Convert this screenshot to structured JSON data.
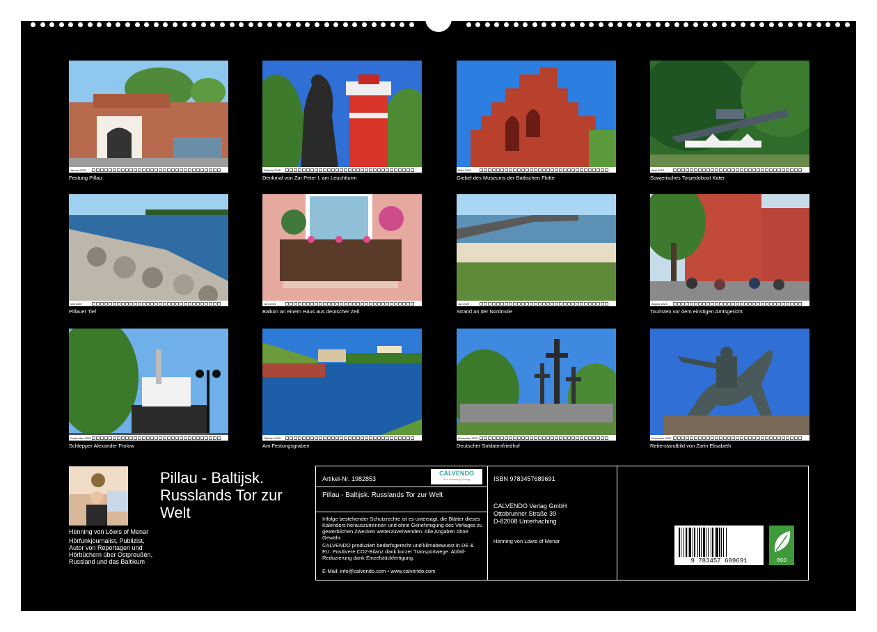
{
  "months": [
    {
      "name": "Januar 2025",
      "caption": "Festung Pillau"
    },
    {
      "name": "Februar 2025",
      "caption": "Denkmal von Zar Peter I. am Leuchtturm"
    },
    {
      "name": "März 2025",
      "caption": "Giebel des Museums der Baltischen Flotte"
    },
    {
      "name": "April 2025",
      "caption": "Sowjetisches Torpedoboot Kater"
    },
    {
      "name": "Mai 2025",
      "caption": "Pillauer Tief"
    },
    {
      "name": "Juni 2025",
      "caption": "Balkon an einem Haus aus deutscher Zeit"
    },
    {
      "name": "Juli 2025",
      "caption": "Strand an der Nordmole"
    },
    {
      "name": "August 2025",
      "caption": "Touristen vor dem einstigen Amtsgericht"
    },
    {
      "name": "September 2025",
      "caption": "Schlepper Alexander Frolow"
    },
    {
      "name": "Oktober 2025",
      "caption": "Am Festungsgraben"
    },
    {
      "name": "November 2025",
      "caption": "Deutscher Soldatenfriedhof"
    },
    {
      "name": "Dezember 2025",
      "caption": "Reiterstandbild von Zarin Elisabeth"
    }
  ],
  "author": {
    "name": "Henning von Löwis of Menar",
    "bio": "Hörfunkjournalist, Publizist, Autor von Reportagen und Hörbüchern über Ostpreußen, Russland und das Baltikum"
  },
  "title": "Pillau - Baltijsk. Russlands Tor zur Welt",
  "info": {
    "article": "Artikel-Nr. 1982853",
    "logo": "CALVENDO",
    "logo_sub": "Bee Marketing Verlag",
    "book_title": "Pillau - Baltijsk. Russlands Tor zur Welt",
    "legal": "Infolge bestehender Schutzrechte ist es untersagt, die Blätter dieses Kalenders herauszutrennen und ohne Genehmigung des Verlages zu gewerblichen Zwecken weiterzuverwenden. Alle Angaben ohne Gewähr.",
    "eco_text": "CALVENDO produziert bedarfsgerecht und klimabewusst in DE & EU. Positivere CO2-Bilanz dank kurzer Transportwege. Abfall-Reduzierung dank Einzelstückfertigung.",
    "contact": "E-Mail: info@calvendo.com • www.calvendo.com",
    "isbn": "ISBN 9783457689691",
    "publisher_name": "CALVENDO Verlag GmbH",
    "publisher_street": "Ottobrunner Straße 39",
    "publisher_city": "D-82008 Unterhaching",
    "author_credit": "Henning von Löwis of Menar",
    "barcode_digits": "9 783457 689691",
    "eco_badge": "eco"
  }
}
